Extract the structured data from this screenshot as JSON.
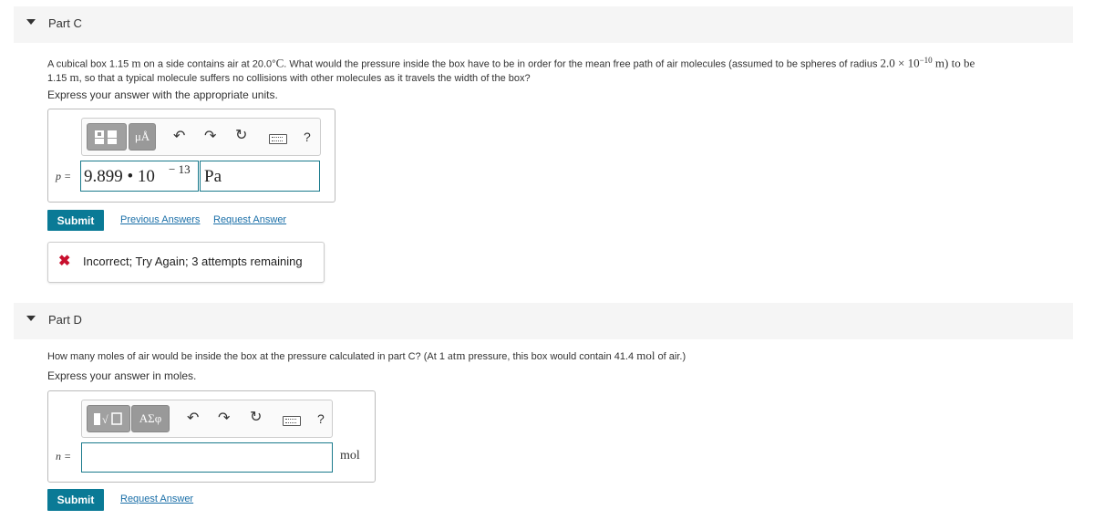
{
  "partC": {
    "title": "Part C",
    "question_a": "A cubical box 1.15 ",
    "unit_m": "m",
    "question_b": " on a side contains air at 20.0°",
    "unit_C": "C",
    "question_c": ". What would the pressure inside the box have to be in order for the mean free path of air molecules (assumed to be spheres of radius ",
    "radius": "2.0 × 10",
    "radius_exp": "−10",
    "question_d": " m) to be ",
    "question_e": "1.15 ",
    "question_f": ", so that a typical molecule suffers no collisions with other molecules as it travels the width of the box?",
    "express": "Express your answer with the appropriate units.",
    "toolbar": {
      "btn2": "μÅ",
      "help": "?"
    },
    "var_label": "p =",
    "value_mantissa": "9.899 • 10",
    "value_exp": "− 13",
    "units_value": "Pa",
    "submit_label": "Submit",
    "previous_answers": "Previous Answers",
    "request_answer": "Request Answer",
    "feedback": "Incorrect; Try Again; 3 attempts remaining"
  },
  "partD": {
    "title": "Part D",
    "question_a": "How many moles of air would be inside the box at the pressure calculated in part C? (At 1 ",
    "unit_atm": "atm",
    "question_b": " pressure, this box would contain 41.4 ",
    "unit_mol": "mol",
    "question_c": " of air.)",
    "express": "Express your answer in moles.",
    "toolbar": {
      "btn2": "ΑΣφ",
      "help": "?"
    },
    "var_label": "n =",
    "value": "",
    "unit_label": "mol",
    "submit_label": "Submit",
    "request_answer": "Request Answer"
  },
  "colors": {
    "accent": "#0a7a96",
    "link": "#1a6fa8",
    "error": "#c8102e",
    "field_border": "#1a7a8c"
  }
}
